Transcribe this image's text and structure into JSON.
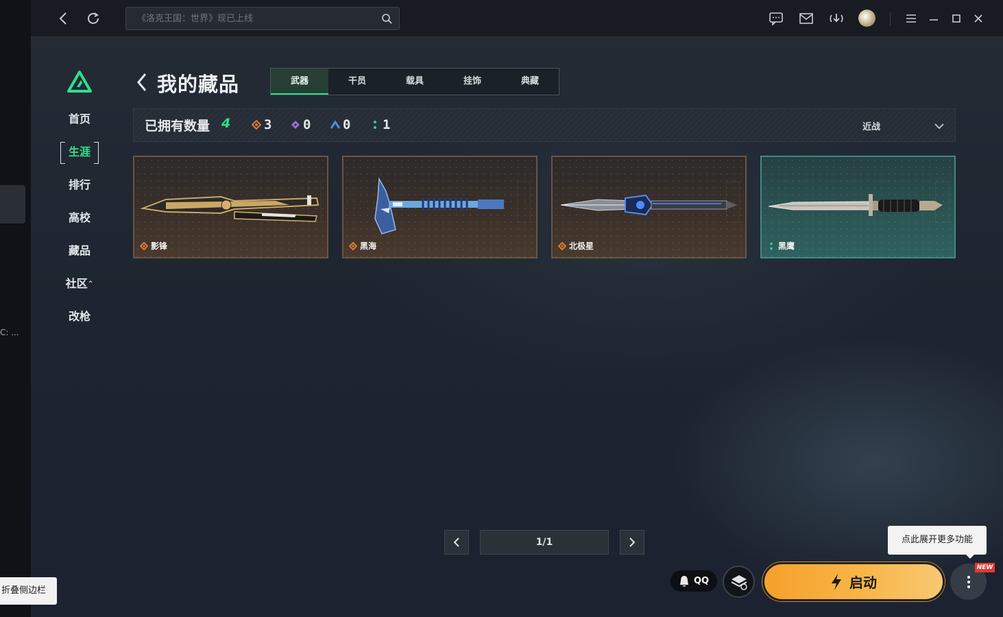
{
  "sidebar_strip": {
    "truncated_text": "C: ...",
    "collapse_tooltip": "折叠侧边栏"
  },
  "topbar": {
    "search_placeholder": "《洛克王国：世界》现已上线",
    "icons": [
      "back-icon",
      "refresh-icon",
      "search-icon",
      "chat-icon",
      "mail-icon",
      "download-icon",
      "avatar",
      "menu-icon",
      "minimize-icon",
      "maximize-icon",
      "close-icon"
    ]
  },
  "nav": {
    "items": [
      {
        "label": "首页"
      },
      {
        "label": "生涯",
        "active": true
      },
      {
        "label": "排行"
      },
      {
        "label": "高校"
      },
      {
        "label": "藏品"
      },
      {
        "label": "社区"
      },
      {
        "label": "改枪"
      }
    ]
  },
  "page": {
    "title": "我的藏品",
    "tabs": [
      {
        "label": "武器",
        "active": true
      },
      {
        "label": "干员"
      },
      {
        "label": "载具"
      },
      {
        "label": "挂饰"
      },
      {
        "label": "典藏"
      }
    ]
  },
  "stats": {
    "owned_label": "已拥有数量",
    "owned_count": "4",
    "rarity_counts": [
      {
        "icon": "orange-diamond-icon",
        "color": "#e07a35",
        "count": "3"
      },
      {
        "icon": "purple-diamond-icon",
        "color": "#9a6ad8",
        "count": "0"
      },
      {
        "icon": "blue-chevron-icon",
        "color": "#4a8fd8",
        "count": "0"
      },
      {
        "icon": "green-dots-icon",
        "color": "#2fd0a0",
        "count": "1"
      }
    ],
    "filter_label": "近战"
  },
  "items": [
    {
      "name": "影锋",
      "rarity": "orange",
      "weapon": "butterfly-knife"
    },
    {
      "name": "黑海",
      "rarity": "orange",
      "weapon": "tomahawk"
    },
    {
      "name": "北极星",
      "rarity": "orange",
      "weapon": "dagger"
    },
    {
      "name": "黑鹰",
      "rarity": "green",
      "weapon": "combat-knife"
    }
  ],
  "pager": {
    "label": "1/1"
  },
  "bottom": {
    "tooltip": "点此展开更多功能",
    "qq_label": "QQ",
    "launch_label": "启动",
    "new_badge": "NEW"
  },
  "colors": {
    "accent": "#2fe08a",
    "launch": "#f6a12a",
    "badge": "#e03a2e"
  }
}
